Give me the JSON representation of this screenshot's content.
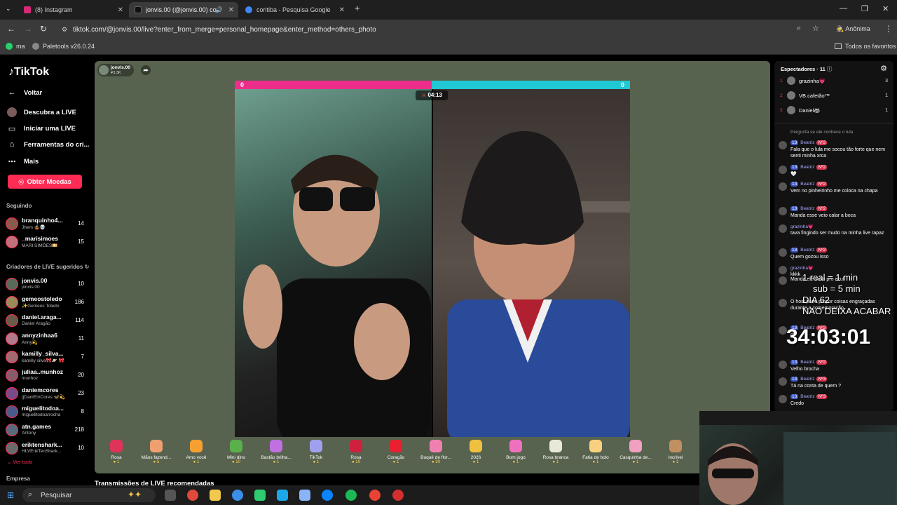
{
  "tabs": [
    {
      "title": "(8) Instagram",
      "color": "#d62976"
    },
    {
      "title": "jonvis.00 (@jonvis.00) come",
      "color": "#111111"
    },
    {
      "title": "coritiba - Pesquisa Google",
      "color": "#4285f4"
    }
  ],
  "new_tab": "+",
  "window": {
    "minimize": "—",
    "restore": "❐",
    "close": "✕"
  },
  "toolbar": {
    "url": "tiktok.com/@jonvis.00/live?enter_from_merge=personal_homepage&enter_method=others_photo",
    "profile": "Anônima"
  },
  "bookmarks": {
    "items": [
      "ma",
      "Paletools v26.0.24"
    ],
    "all": "Todos os favoritos"
  },
  "sidebar": {
    "logo": "TikTok",
    "back": "Voltar",
    "nav": [
      "Descubra a LIVE",
      "Iniciar uma LIVE",
      "Ferramentas do cri...",
      "Mais"
    ],
    "coins": "Obter Moedas",
    "following_title": "Seguindo",
    "following": [
      {
        "name": "branquinho4...",
        "sub": "Jhem 🤹💀",
        "count": "14",
        "color": "#8a5a4a"
      },
      {
        "name": "_marisimoes",
        "sub": "MARI SIMÕES💴",
        "count": "15",
        "color": "#c0707a"
      }
    ],
    "suggested_title": "Criadores de LIVE sugeridos",
    "suggested": [
      {
        "name": "jonvis.00",
        "sub": "jonvis.00",
        "count": "10",
        "color": "#5a6a5a"
      },
      {
        "name": "gemeostoledo",
        "sub": "✨Gemeos Toledo",
        "count": "186",
        "color": "#9a8a5a"
      },
      {
        "name": "daniel.araga...",
        "sub": "Daniel Aragão",
        "count": "114",
        "color": "#6a5a4a"
      },
      {
        "name": "annyzinhaa6",
        "sub": "Anny💫",
        "count": "11",
        "color": "#b07a8a"
      },
      {
        "name": "kamilly_silva...",
        "sub": "kamilly silva🎀🪐 🎀",
        "count": "7",
        "color": "#a06a70"
      },
      {
        "name": "juliaa..munhoz",
        "sub": "munhoz",
        "count": "20",
        "color": "#8a5a6a"
      },
      {
        "name": "daniemcores",
        "sub": "||DaniEmCores 🦋💫",
        "count": "23",
        "color": "#7a4a8a"
      },
      {
        "name": "miguelitodoa...",
        "sub": "miguelitodoarrocha",
        "count": "8",
        "color": "#4a5a8a"
      },
      {
        "name": "atn.games",
        "sub": "Antony",
        "count": "218",
        "color": "#5a6a7a"
      },
      {
        "name": "eriktenshark...",
        "sub": "HLVErikTenShark...",
        "count": "10",
        "color": "#6a6a6a"
      }
    ],
    "see_all": "Ver tudo",
    "company": "Empresa"
  },
  "live": {
    "host": "jonvis.00",
    "host_likes": "3.3K",
    "score_left": "0",
    "score_right": "0",
    "timer": "04:13",
    "gifts": [
      {
        "name": "Rosa",
        "price": "1",
        "color": "#e0335a"
      },
      {
        "name": "Mãos fazend...",
        "price": "5",
        "color": "#f0a070"
      },
      {
        "name": "Amo você",
        "price": "1",
        "color": "#f5a030"
      },
      {
        "name": "Mini dino",
        "price": "10",
        "color": "#5ab04a"
      },
      {
        "name": "Bastão brilha...",
        "price": "1",
        "color": "#c070e0"
      },
      {
        "name": "TikTok",
        "price": "1",
        "color": "#a0a0f0"
      },
      {
        "name": "Rosa",
        "price": "10",
        "color": "#d02040"
      },
      {
        "name": "Coração",
        "price": "1",
        "color": "#e82030"
      },
      {
        "name": "Buquê de flor...",
        "price": "30",
        "color": "#f080b0"
      },
      {
        "name": "2026",
        "price": "1",
        "color": "#f0c040"
      },
      {
        "name": "Bom jogo",
        "price": "1",
        "color": "#f070c0"
      },
      {
        "name": "Rosa branca",
        "price": "1",
        "color": "#e8e8d8"
      },
      {
        "name": "Fatia de bolo",
        "price": "1",
        "color": "#f8d080"
      },
      {
        "name": "Casquinha de...",
        "price": "1",
        "color": "#f0a0c0"
      },
      {
        "name": "Incrível",
        "price": "1",
        "color": "#c09060"
      }
    ],
    "recommended": "Transmissões de LIVE recomendadas"
  },
  "panel": {
    "viewers_title": "Espectadores · 11",
    "viewers": [
      {
        "rank": "1",
        "name": "grazinha💗",
        "count": "3"
      },
      {
        "rank": "2",
        "name": "VB.cafetão™",
        "count": "1"
      },
      {
        "rank": "3",
        "name": "Daniel🦝",
        "count": "1"
      }
    ],
    "pinned": "Pergunta se ele conhece o lula",
    "messages": [
      {
        "name": "Beatriz",
        "lvl": "13",
        "badge": "Nº2",
        "text": "Fala que o lula me socou tão forte que nem senti minha xrca"
      },
      {
        "name": "Beatriz",
        "lvl": "13",
        "badge": "Nº2",
        "text": "🤍"
      },
      {
        "name": "Beatriz",
        "lvl": "13",
        "badge": "Nº2",
        "text": "Vem no pinheirinho me coloca na chapa"
      },
      {
        "name": "Beatriz",
        "lvl": "13",
        "badge": "Nº2",
        "text": "Manda esse veio calar a boca"
      },
      {
        "name": "grazinha💗",
        "lvl": "",
        "badge": "",
        "text": "tava fingindo ser mudo na minha live rapaz"
      },
      {
        "name": "Beatriz",
        "lvl": "13",
        "badge": "Nº2",
        "text": "Quem gozou isso"
      },
      {
        "name": "grazinha💗",
        "lvl": "",
        "badge": "",
        "text": "kkkk"
      },
      {
        "name": "",
        "lvl": "",
        "badge": "",
        "text": "Manda ele volta pro azul"
      },
      {
        "name": "",
        "lvl": "",
        "badge": "",
        "text": "O host pode propor coisas engraçadas durante a comemoração."
      },
      {
        "name": "Beatriz",
        "lvl": "13",
        "badge": "Nº2",
        "text": "rlx"
      },
      {
        "name": "Beatriz",
        "lvl": "13",
        "badge": "Nº2",
        "text": "Velho brocha"
      },
      {
        "name": "Beatriz",
        "lvl": "13",
        "badge": "Nº3",
        "text": "Tá na conta de quem ?"
      },
      {
        "name": "Beatriz",
        "lvl": "13",
        "badge": "Nº3",
        "text": "Credo"
      }
    ]
  },
  "overlay": {
    "line1": "1 real = 1 min",
    "line2": "sub = 5 min",
    "line3": "DIA 62",
    "line4": "NAO DEIXA ACABAR",
    "timer": "34:03:01"
  },
  "taskbar": {
    "search": "Pesquisar"
  }
}
